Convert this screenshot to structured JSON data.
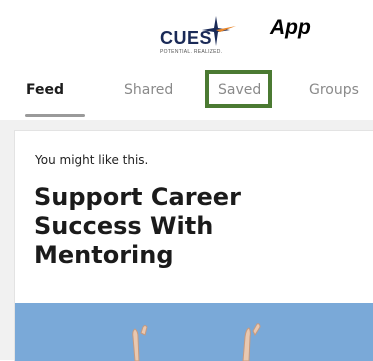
{
  "header": {
    "logo_text": "CUES",
    "logo_tagline": "POTENTIAL. REALIZED.",
    "app_label": "App"
  },
  "tabs": [
    {
      "label": "Feed",
      "active": true
    },
    {
      "label": "Shared",
      "active": false
    },
    {
      "label": "Saved",
      "active": false,
      "highlighted": true
    },
    {
      "label": "Groups",
      "active": false
    }
  ],
  "card": {
    "kicker": "You might like this.",
    "title": "Support Career Success With Mentoring",
    "image": "celebrating-hands-photo"
  },
  "colors": {
    "highlight_box": "#4b7a32",
    "brand_navy": "#1a2a57",
    "brand_orange": "#e8862a",
    "sky_blue": "#78a8d8"
  }
}
